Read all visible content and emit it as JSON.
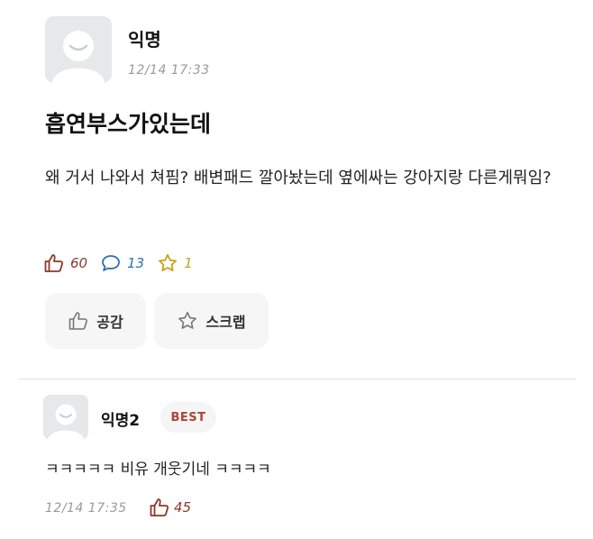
{
  "post": {
    "author": "익명",
    "timestamp": "12/14 17:33",
    "title": "흡연부스가있는데",
    "body": "왜 거서 나와서 쳐핌? 배변패드 깔아놨는데 옆에싸는 강아지랑 다른게뭐임?",
    "stats": {
      "likes": "60",
      "comments": "13",
      "scraps": "1"
    },
    "actions": {
      "like_label": "공감",
      "scrap_label": "스크랩"
    }
  },
  "comment": {
    "author": "익명2",
    "badge": "BEST",
    "text": "ㅋㅋㅋㅋㅋ 비유 개웃기네 ㅋㅋㅋㅋ",
    "timestamp": "12/14 17:35",
    "likes": "45"
  },
  "icons": {
    "avatar": "default-avatar-icon",
    "like": "thumbs-up-icon",
    "comment": "speech-bubble-icon",
    "scrap": "star-icon"
  },
  "colors": {
    "like": "#8a3a2a",
    "comment": "#2d6fb8",
    "scrap": "#c8a21c",
    "best_badge": "#b34236"
  }
}
